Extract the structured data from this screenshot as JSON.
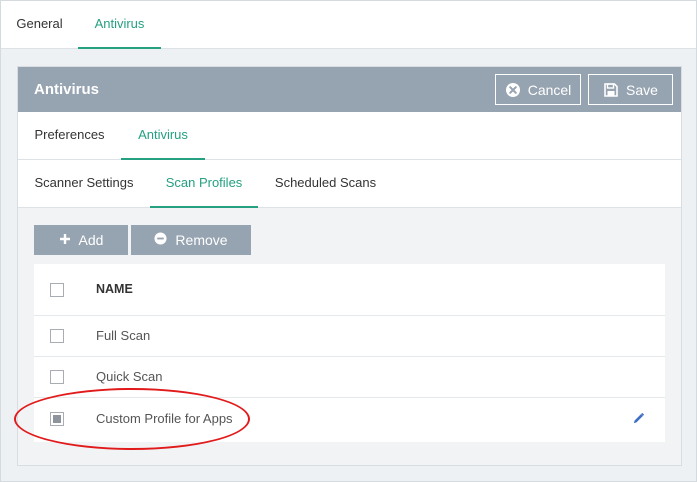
{
  "top_tabs": {
    "general": "General",
    "antivirus": "Antivirus"
  },
  "panel": {
    "title": "Antivirus",
    "cancel_label": "Cancel",
    "save_label": "Save"
  },
  "sub_tabs": {
    "preferences": "Preferences",
    "antivirus": "Antivirus"
  },
  "antivirus_tabs": {
    "scanner_settings": "Scanner Settings",
    "scan_profiles": "Scan Profiles",
    "scheduled_scans": "Scheduled Scans"
  },
  "toolbar": {
    "add_label": "Add",
    "remove_label": "Remove"
  },
  "table": {
    "column_name": "NAME",
    "rows": [
      {
        "name": "Full Scan",
        "checked": false
      },
      {
        "name": "Quick Scan",
        "checked": false
      },
      {
        "name": "Custom Profile for Apps",
        "checked": "partial"
      }
    ]
  },
  "colors": {
    "accent": "#25a080",
    "header_bg": "#96a3b0",
    "annotation": "#e11b1b"
  },
  "icons": [
    "cancel-icon",
    "save-icon",
    "plus-icon",
    "minus-circle-icon",
    "pencil-icon"
  ]
}
